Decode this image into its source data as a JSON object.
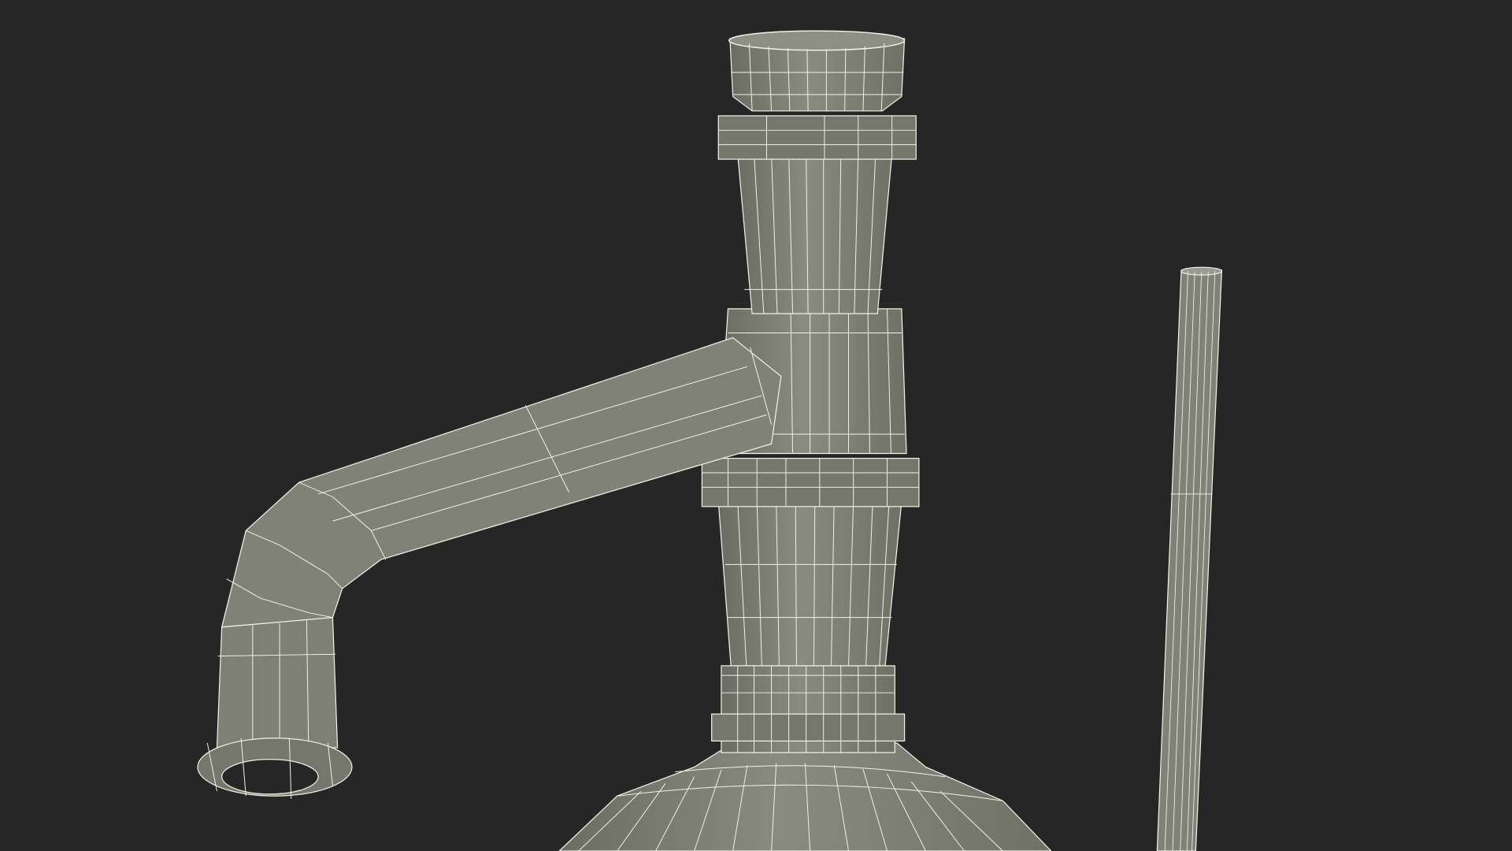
{
  "scene": {
    "background": "#262626",
    "mesh_fill": "#7d7e73",
    "mesh_fill_light": "#8c8d82",
    "mesh_fill_dark": "#66675d",
    "wire_color": "#f2f2e8",
    "objects": [
      "column",
      "spout-pipe",
      "thin-rod"
    ]
  }
}
